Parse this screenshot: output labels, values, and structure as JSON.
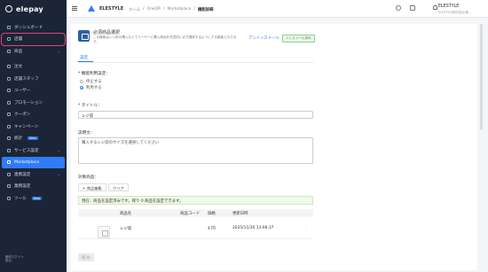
{
  "app": {
    "logo_text": "elepay"
  },
  "sidebar": {
    "items": [
      {
        "label": "ダッシュボード",
        "icon": "home-icon"
      },
      {
        "label": "店舗",
        "icon": "store-icon",
        "highlighted": true
      },
      {
        "label": "商品",
        "icon": "tag-icon",
        "chevron": true
      },
      {
        "label": "注文",
        "icon": "cart-icon"
      },
      {
        "label": "店舗スタッフ",
        "icon": "staff-icon"
      },
      {
        "label": "ユーザー",
        "icon": "user-icon"
      },
      {
        "label": "プロモーション",
        "icon": "megaphone-icon"
      },
      {
        "label": "クーポン",
        "icon": "coupon-icon"
      },
      {
        "label": "キャンペーン",
        "icon": "flag-icon"
      },
      {
        "label": "統計",
        "icon": "chart-icon",
        "badge": "Beta"
      },
      {
        "label": "サービス設定",
        "icon": "gear-icon",
        "chevron": true
      },
      {
        "label": "Marketplace",
        "icon": "grid-icon",
        "active": true
      },
      {
        "label": "連携設定",
        "icon": "link-icon",
        "chevron": true
      },
      {
        "label": "業務設定",
        "icon": "briefcase-icon"
      },
      {
        "label": "ツール",
        "icon": "tool-icon",
        "badge": "Beta"
      }
    ],
    "footer_line1": "最終ログイン:",
    "footer_line2": "設定:"
  },
  "topbar": {
    "brand": "ELESTYLE",
    "breadcrumb": [
      "ホーム",
      "OneQR",
      "Marketplace",
      "機能詳細"
    ],
    "user_name": "ELESTYLE",
    "user_sub": "ELESTYLE株式会社(管..."
  },
  "feature": {
    "title": "必須商品選択",
    "description": "この機能はレジ前の購入などでユーザーに購入商品を任意的に必ず選択するようにする機能となります。",
    "uninstall_label": "アンインストール",
    "status_badge": "インストール済み"
  },
  "tabs": [
    "設定"
  ],
  "form": {
    "usage_label": "* 機能利用設定：",
    "options": [
      "停止する",
      "利用する"
    ],
    "selected_option": 1,
    "title_label": "* タイトル：",
    "title_value": "レジ袋",
    "desc_label": "説明文：",
    "desc_value": "購入するレジ袋のサイズを選択してください",
    "products_label": "対象商品：",
    "edit_products_button": "+ 商品編集",
    "clear_button": "クリア",
    "notice": "現在：商品を設定済みです。残り 0 商品を設定できます。",
    "table": {
      "columns": [
        "商品名",
        "商品コード",
        "価格",
        "更新日時"
      ],
      "rows": [
        {
          "name": "レジ袋",
          "code": "",
          "price": "4 円",
          "updated": "2025/11/20 13:08:37"
        }
      ]
    },
    "save_button": "保 存"
  },
  "colors": {
    "accent": "#2f7cf6",
    "sidebar_bg": "#1b2536",
    "highlight": "#e0457a"
  }
}
